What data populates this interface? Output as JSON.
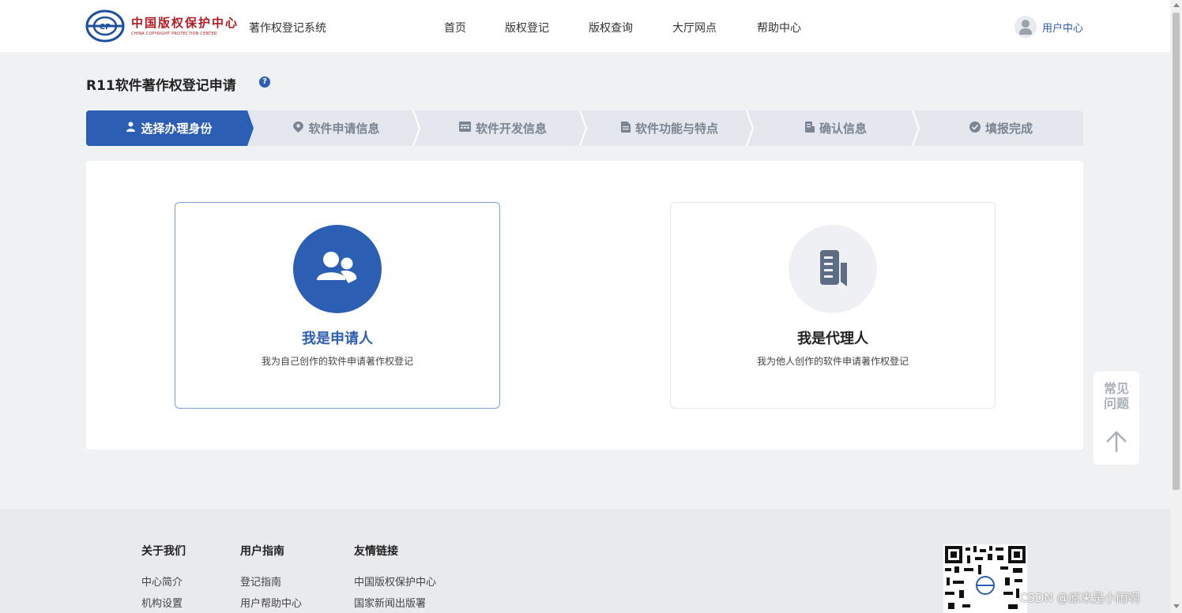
{
  "header": {
    "logo_cn": "中国版权保护中心",
    "logo_en": "CHINA COPYRIGHT PROTECTION CENTER",
    "system_name": "著作权登记系统",
    "nav": [
      "首页",
      "版权登记",
      "版权查询",
      "大厅网点",
      "帮助中心"
    ],
    "user_center": "用户中心"
  },
  "page": {
    "title": "R11软件著作权登记申请",
    "help_icon": "?"
  },
  "steps": [
    {
      "label": "选择办理身份",
      "icon": "user-icon",
      "active": true
    },
    {
      "label": "软件申请信息",
      "icon": "location-icon",
      "active": false
    },
    {
      "label": "软件开发信息",
      "icon": "calendar-icon",
      "active": false
    },
    {
      "label": "软件功能与特点",
      "icon": "document-icon",
      "active": false
    },
    {
      "label": "确认信息",
      "icon": "id-card-icon",
      "active": false
    },
    {
      "label": "填报完成",
      "icon": "check-circle-icon",
      "active": false
    }
  ],
  "cards": {
    "applicant": {
      "title": "我是申请人",
      "desc": "我为自己创作的软件申请著作权登记",
      "selected": true
    },
    "agent": {
      "title": "我是代理人",
      "desc": "我为他人创作的软件申请著作权登记",
      "selected": false
    }
  },
  "faq": {
    "line1": "常见",
    "line2": "问题"
  },
  "footer": {
    "col1": {
      "title": "关于我们",
      "links": [
        "中心简介",
        "机构设置"
      ]
    },
    "col2": {
      "title": "用户指南",
      "links": [
        "登记指南",
        "用户帮助中心"
      ]
    },
    "col3": {
      "title": "友情链接",
      "links": [
        "中国版权保护中心",
        "国家新闻出版署"
      ]
    }
  },
  "watermark": "CSDN @原来是小雨啊",
  "colors": {
    "primary": "#2c5fb4",
    "logo_red": "#b01c22",
    "step_bg": "#e4e8ee"
  }
}
